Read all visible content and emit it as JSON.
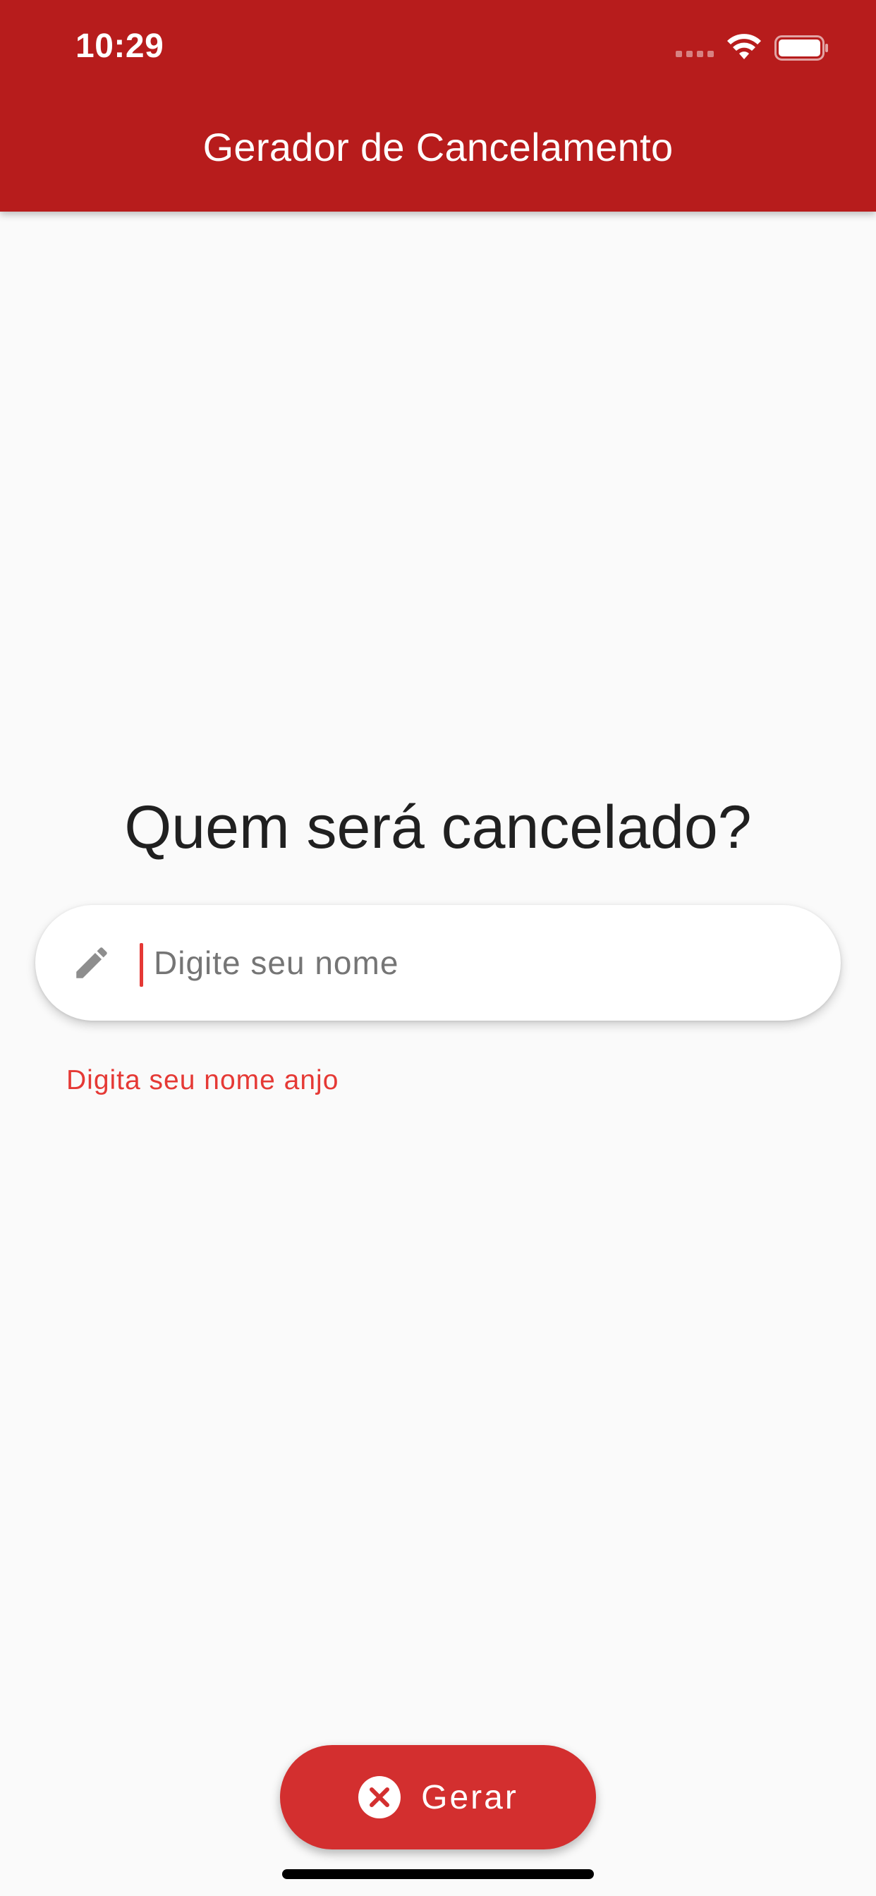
{
  "status_bar": {
    "time": "10:29",
    "icons": [
      "signal-icon",
      "wifi-icon",
      "battery-icon"
    ]
  },
  "app_bar": {
    "title": "Gerador de Cancelamento",
    "color": "#b71c1c"
  },
  "main": {
    "headline": "Quem será cancelado?",
    "name_field": {
      "placeholder": "Digite seu nome",
      "value": "",
      "icon": "pencil-icon"
    },
    "error_message": "Digita seu nome anjo"
  },
  "action_button": {
    "label": "Gerar",
    "icon": "close-circle-icon",
    "color": "#d32f2f"
  },
  "colors": {
    "background": "#fafafa",
    "error": "#e53935"
  }
}
